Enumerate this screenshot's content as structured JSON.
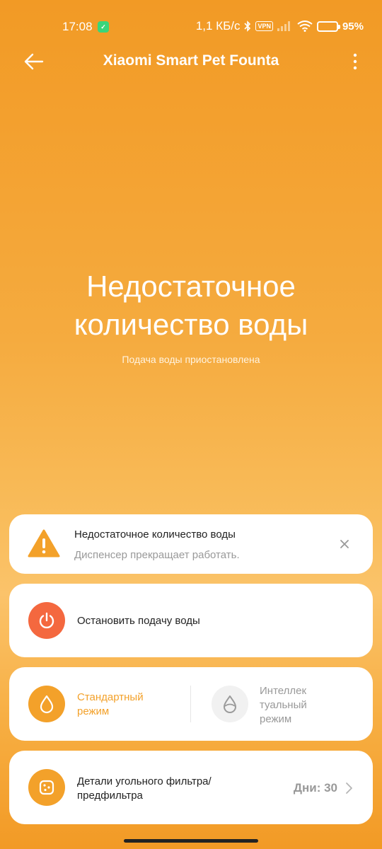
{
  "status_bar": {
    "time": "17:08",
    "network_speed": "1,1 КБ/с",
    "vpn": "VPN",
    "battery": "95%",
    "icons": [
      "mi-home-icon",
      "bluetooth-icon",
      "vpn-icon",
      "signal-icon",
      "wifi-icon",
      "battery-icon"
    ]
  },
  "app_bar": {
    "title": "Xiaomi Smart Pet Founta",
    "back_icon": "arrow-left-icon",
    "more_icon": "more-vertical-icon"
  },
  "hero": {
    "title_line1": "Недостаточное",
    "title_line2": "количество воды",
    "subtitle": "Подача воды приостановлена"
  },
  "alert_card": {
    "title": "Недостаточное количество воды",
    "description": "Диспенсер прекращает работать.",
    "icon": "warning-icon",
    "close_icon": "close-icon"
  },
  "stop_card": {
    "label": "Остановить подачу воды",
    "icon": "power-icon"
  },
  "mode_card": {
    "standard_label": "Стандартный режим",
    "smart_label": "Интеллек туальный режим",
    "standard_icon": "water-drop-icon",
    "smart_icon": "water-drop-half-icon",
    "active_mode": "standard"
  },
  "filter_card": {
    "label": "Детали угольного фильтра/ предфильтра",
    "days": "Дни: 30",
    "icon": "filter-icon",
    "chevron_icon": "chevron-right-icon"
  },
  "colors": {
    "accent": "#f3a12a",
    "power": "#f4683f",
    "background_top": "#f29a25",
    "background_mid": "#fbc36a"
  }
}
